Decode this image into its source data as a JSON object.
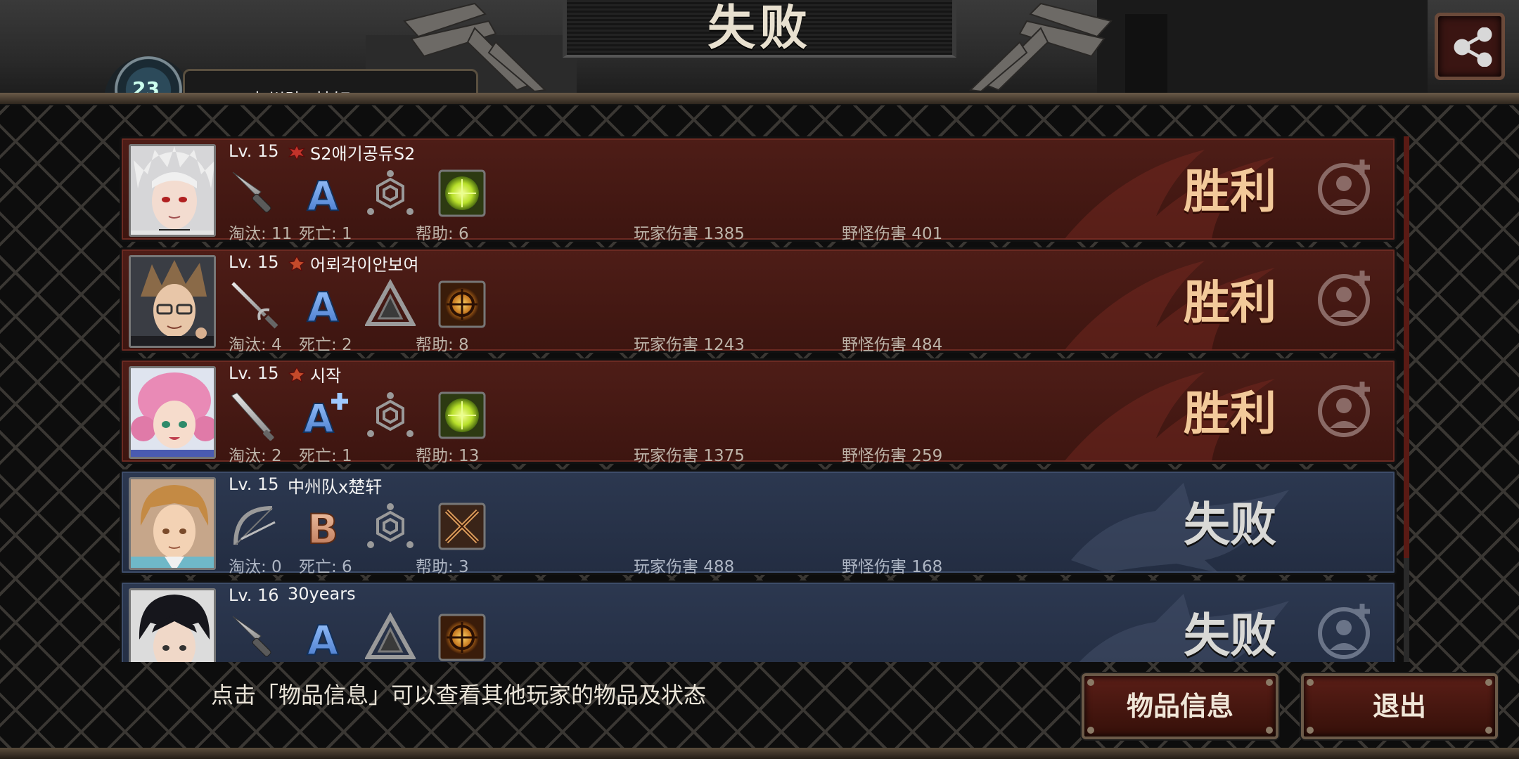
{
  "header": {
    "title": "失败",
    "player_level": "23",
    "player_name": "中州队x楚轩"
  },
  "players": [
    {
      "level": "Lv. 15",
      "name": "S2애기공듀S2",
      "result": "胜利",
      "team": "win",
      "weapon_icon": "knife-icon",
      "grade": "A",
      "eliminations": "淘汰: 11",
      "deaths": "死亡: 1",
      "assists": "帮助: 6",
      "player_damage": "玩家伤害 1385",
      "monster_damage": "野怪伤害 401"
    },
    {
      "level": "Lv. 15",
      "name": "어뢰각이안보여",
      "result": "胜利",
      "team": "win",
      "weapon_icon": "rapier-icon",
      "grade": "A",
      "eliminations": "淘汰: 4",
      "deaths": "死亡: 2",
      "assists": "帮助: 8",
      "player_damage": "玩家伤害 1243",
      "monster_damage": "野怪伤害 484"
    },
    {
      "level": "Lv. 15",
      "name": "시작",
      "result": "胜利",
      "team": "win",
      "weapon_icon": "bat-icon",
      "grade": "A+",
      "eliminations": "淘汰: 2",
      "deaths": "死亡: 1",
      "assists": "帮助: 13",
      "player_damage": "玩家伤害 1375",
      "monster_damage": "野怪伤害 259"
    },
    {
      "level": "Lv. 15",
      "name": "中州队x楚轩",
      "result": "失败",
      "team": "lose",
      "weapon_icon": "bow-icon",
      "grade": "B",
      "eliminations": "淘汰: 0",
      "deaths": "死亡: 6",
      "assists": "帮助: 3",
      "player_damage": "玩家伤害 488",
      "monster_damage": "野怪伤害 168"
    },
    {
      "level": "Lv. 16",
      "name": "30years",
      "result": "失败",
      "team": "lose",
      "weapon_icon": "knife-icon",
      "grade": "A"
    }
  ],
  "footer": {
    "hint": "点击「物品信息」可以查看其他玩家的物品及状态",
    "items_button": "物品信息",
    "exit_button": "退出"
  },
  "colors": {
    "win_row": "#4e1d17",
    "lose_row": "#2c3850",
    "win_text": "#f2c99a",
    "lose_text": "#d9d9d6"
  }
}
